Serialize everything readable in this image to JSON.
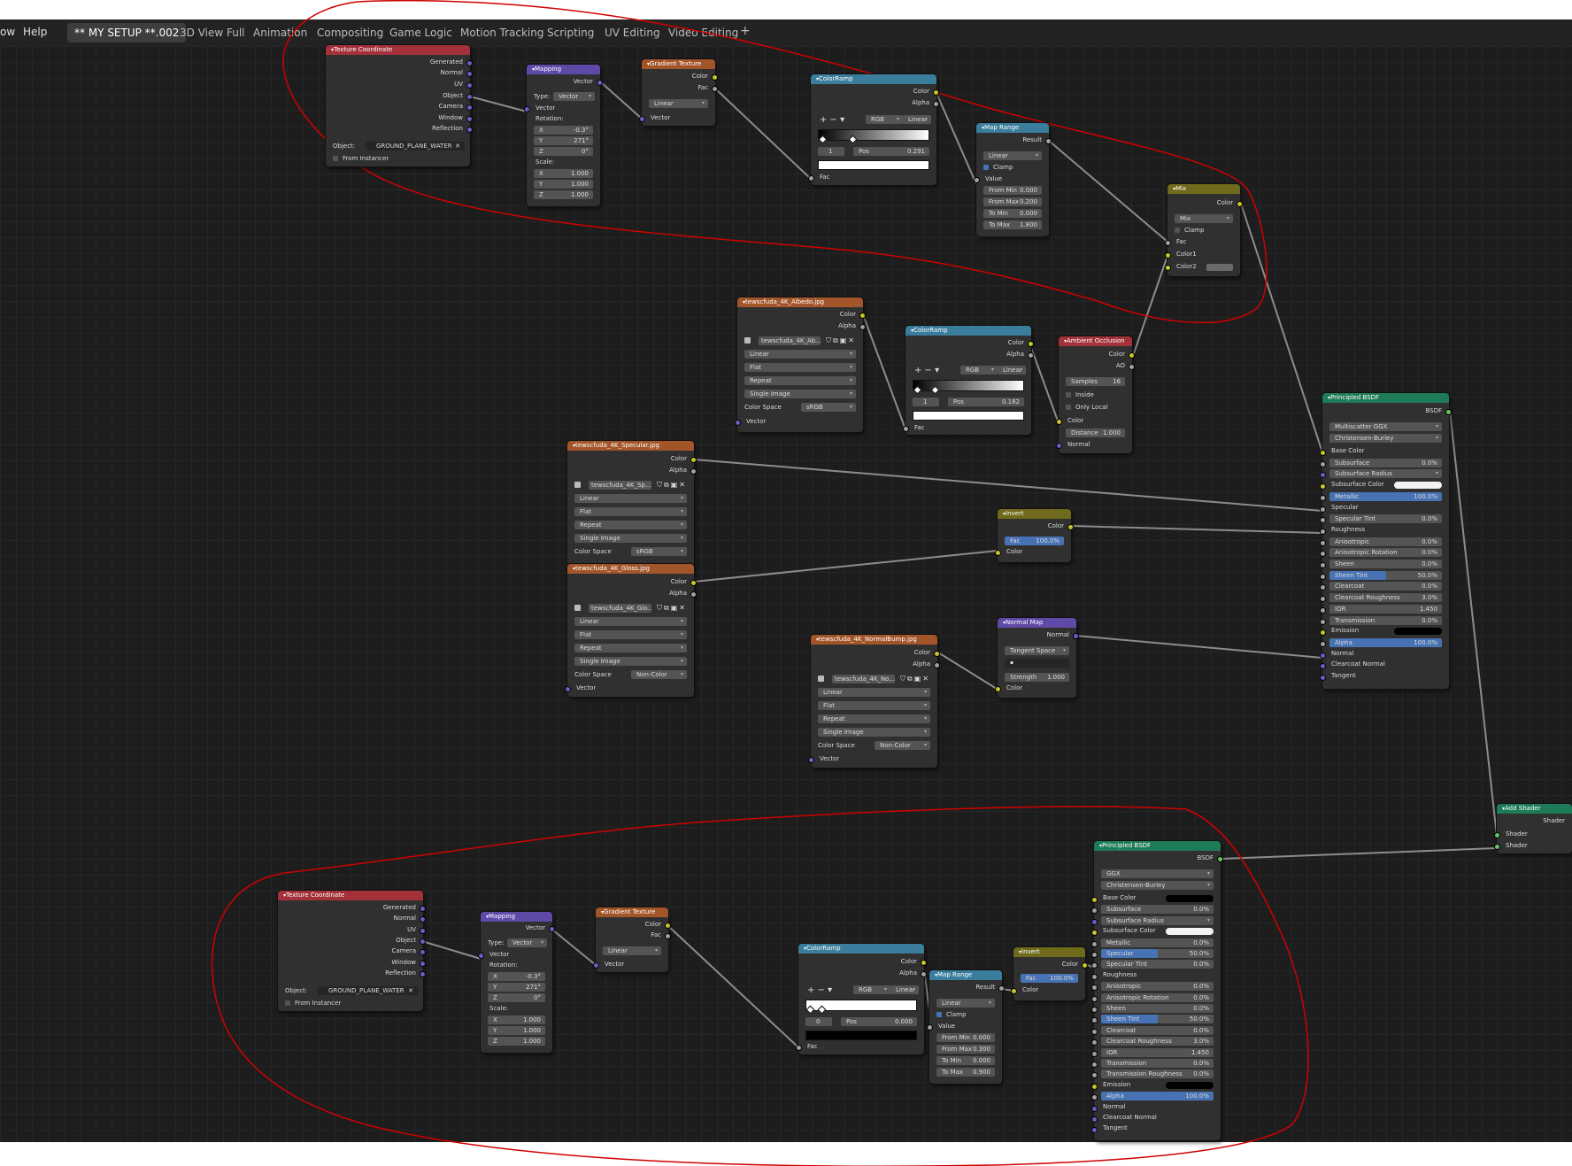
{
  "menu": {
    "items": [
      "ow",
      "Help"
    ],
    "workspaces": [
      "** MY SETUP **.002",
      "3D View Full",
      "Animation",
      "Compositing",
      "Game Logic",
      "Motion Tracking",
      "Scripting",
      "UV Editing",
      "Video Editing",
      "+"
    ]
  },
  "colors": {
    "texture_header": "#a3313a",
    "vector_header": "#5f4aa8",
    "image_header": "#a3552a",
    "converter_header": "#3a7d9c",
    "color_header": "#6f6a1c",
    "shader_header": "#1e7b58",
    "annotation": "#d10000"
  },
  "nodes": {
    "texcoord_top": {
      "title": "Texture Coordinate",
      "outs": [
        "Generated",
        "Normal",
        "UV",
        "Object",
        "Camera",
        "Window",
        "Reflection"
      ],
      "object_label": "Object:",
      "object_value": "GROUND_PLANE_WATER",
      "from_instancer": "From Instancer"
    },
    "mapping_top": {
      "title": "Mapping",
      "out": "Vector",
      "type_label": "Type:",
      "type_value": "Vector",
      "vector": "Vector",
      "rotation": "Rotation:",
      "rot": [
        [
          "X",
          "-0.3°"
        ],
        [
          "Y",
          "271°"
        ],
        [
          "Z",
          "0°"
        ]
      ],
      "scale": "Scale:",
      "scl": [
        [
          "X",
          "1.000"
        ],
        [
          "Y",
          "1.000"
        ],
        [
          "Z",
          "1.000"
        ]
      ]
    },
    "gradient_top": {
      "title": "Gradient Texture",
      "outs": [
        "Color",
        "Fac"
      ],
      "mode": "Linear",
      "in": "Vector"
    },
    "ramp_top": {
      "title": "ColorRamp",
      "outs": [
        "Color",
        "Alpha"
      ],
      "mode": "RGB",
      "interp": "Linear",
      "index": "1",
      "pos_label": "Pos",
      "pos": "0.291",
      "in": "Fac"
    },
    "maprange_top": {
      "title": "Map Range",
      "out": "Result",
      "mode": "Linear",
      "clamp": "Clamp",
      "value": "Value",
      "rows": [
        [
          "From Min",
          "0.000"
        ],
        [
          "From Max",
          "0.200"
        ],
        [
          "To Min",
          "0.000"
        ],
        [
          "To Max",
          "1.800"
        ]
      ]
    },
    "mix": {
      "title": "Mix",
      "out": "Color",
      "mode": "Mix",
      "clamp": "Clamp",
      "ins": [
        "Fac",
        "Color1",
        "Color2"
      ]
    },
    "albedo": {
      "title": "tewscfuda_4K_Albedo.jpg",
      "outs": [
        "Color",
        "Alpha"
      ],
      "file": "tewscfuda_4K_Ab...",
      "opts": [
        "Linear",
        "Flat",
        "Repeat",
        "Single Image"
      ],
      "cs_label": "Color Space",
      "cs": "sRGB",
      "in": "Vector"
    },
    "ramp_mid": {
      "title": "ColorRamp",
      "outs": [
        "Color",
        "Alpha"
      ],
      "mode": "RGB",
      "interp": "Linear",
      "index": "1",
      "pos_label": "Pos",
      "pos": "0.182",
      "in": "Fac"
    },
    "ao": {
      "title": "Ambient Occlusion",
      "outs": [
        "Color",
        "AO"
      ],
      "samples_label": "Samples",
      "samples": "16",
      "inside": "Inside",
      "only_local": "Only Local",
      "ins": [
        "Color",
        "Normal"
      ],
      "dist_label": "Distance",
      "dist": "1.000"
    },
    "specular": {
      "title": "tewscfuda_4K_Specular.jpg",
      "outs": [
        "Color",
        "Alpha"
      ],
      "file": "tewscfuda_4K_Sp...",
      "opts": [
        "Linear",
        "Flat",
        "Repeat",
        "Single Image"
      ],
      "cs_label": "Color Space",
      "cs": "sRGB"
    },
    "gloss": {
      "title": "tewscfuda_4K_Gloss.jpg",
      "outs": [
        "Color",
        "Alpha"
      ],
      "file": "tewscfuda_4K_Glo...",
      "opts": [
        "Linear",
        "Flat",
        "Repeat",
        "Single Image"
      ],
      "cs_label": "Color Space",
      "cs": "Non-Color",
      "in": "Vector"
    },
    "invert_mid": {
      "title": "Invert",
      "out": "Color",
      "fac_label": "Fac",
      "fac": "100.0%",
      "in": "Color"
    },
    "normalmap": {
      "title": "Normal Map",
      "out": "Normal",
      "space": "Tangent Space",
      "strength_label": "Strength",
      "strength": "1.000",
      "in": "Color"
    },
    "normalbump": {
      "title": "tewscfuda_4K_NormalBump.jpg",
      "outs": [
        "Color",
        "Alpha"
      ],
      "file": "tewscfuda_4K_No...",
      "opts": [
        "Linear",
        "Flat",
        "Repeat",
        "Single Image"
      ],
      "cs_label": "Color Space",
      "cs": "Non-Color",
      "in": "Vector"
    },
    "bsdf_top": {
      "title": "Principled BSDF",
      "out": "BSDF",
      "dist": "Multiscatter GGX",
      "sss": "Christensen-Burley",
      "rows": [
        [
          "Base Color",
          ""
        ],
        [
          "Subsurface",
          "0.0%"
        ],
        [
          "Subsurface Radius",
          ""
        ],
        [
          "Subsurface Color",
          ""
        ],
        [
          "Metallic",
          "100.0%"
        ],
        [
          "Specular",
          ""
        ],
        [
          "Specular Tint",
          "0.0%"
        ],
        [
          "Roughness",
          ""
        ],
        [
          "Anisotropic",
          "0.0%"
        ],
        [
          "Anisotropic Rotation",
          "0.0%"
        ],
        [
          "Sheen",
          "0.0%"
        ],
        [
          "Sheen Tint",
          "50.0%"
        ],
        [
          "Clearcoat",
          "0.0%"
        ],
        [
          "Clearcoat Roughness",
          "3.0%"
        ],
        [
          "IOR",
          "1.450"
        ],
        [
          "Transmission",
          "0.0%"
        ],
        [
          "Emission",
          ""
        ],
        [
          "Alpha",
          "100.0%"
        ],
        [
          "Normal",
          ""
        ],
        [
          "Clearcoat Normal",
          ""
        ],
        [
          "Tangent",
          ""
        ]
      ]
    },
    "addshader": {
      "title": "Add Shader",
      "out": "Shader",
      "ins": [
        "Shader",
        "Shader"
      ]
    },
    "texcoord_bot": {
      "title": "Texture Coordinate",
      "outs": [
        "Generated",
        "Normal",
        "UV",
        "Object",
        "Camera",
        "Window",
        "Reflection"
      ],
      "object_label": "Object:",
      "object_value": "GROUND_PLANE_WATER",
      "from_instancer": "From Instancer"
    },
    "mapping_bot": {
      "title": "Mapping",
      "out": "Vector",
      "type_label": "Type:",
      "type_value": "Vector",
      "vector": "Vector",
      "rotation": "Rotation:",
      "rot": [
        [
          "X",
          "-0.3°"
        ],
        [
          "Y",
          "271°"
        ],
        [
          "Z",
          "0°"
        ]
      ],
      "scale": "Scale:",
      "scl": [
        [
          "X",
          "1.000"
        ],
        [
          "Y",
          "1.000"
        ],
        [
          "Z",
          "1.000"
        ]
      ]
    },
    "gradient_bot": {
      "title": "Gradient Texture",
      "outs": [
        "Color",
        "Fac"
      ],
      "mode": "Linear",
      "in": "Vector"
    },
    "ramp_bot": {
      "title": "ColorRamp",
      "outs": [
        "Color",
        "Alpha"
      ],
      "mode": "RGB",
      "interp": "Linear",
      "index": "0",
      "pos_label": "Pos",
      "pos": "0.000",
      "in": "Fac"
    },
    "maprange_bot": {
      "title": "Map Range",
      "out": "Result",
      "mode": "Linear",
      "clamp": "Clamp",
      "value": "Value",
      "rows": [
        [
          "From Min",
          "0.000"
        ],
        [
          "From Max",
          "0.300"
        ],
        [
          "To Min",
          "0.000"
        ],
        [
          "To Max",
          "0.900"
        ]
      ]
    },
    "invert_bot": {
      "title": "Invert",
      "out": "Color",
      "fac_label": "Fac",
      "fac": "100.0%",
      "in": "Color"
    },
    "bsdf_bot": {
      "title": "Principled BSDF",
      "out": "BSDF",
      "dist": "GGX",
      "sss": "Christensen-Burley",
      "rows": [
        [
          "Base Color",
          ""
        ],
        [
          "Subsurface",
          "0.0%"
        ],
        [
          "Subsurface Radius",
          ""
        ],
        [
          "Subsurface Color",
          ""
        ],
        [
          "Metallic",
          "0.0%"
        ],
        [
          "Specular",
          "50.0%"
        ],
        [
          "Specular Tint",
          "0.0%"
        ],
        [
          "Roughness",
          ""
        ],
        [
          "Anisotropic",
          "0.0%"
        ],
        [
          "Anisotropic Rotation",
          "0.0%"
        ],
        [
          "Sheen",
          "0.0%"
        ],
        [
          "Sheen Tint",
          "50.0%"
        ],
        [
          "Clearcoat",
          "0.0%"
        ],
        [
          "Clearcoat Roughness",
          "3.0%"
        ],
        [
          "IOR",
          "1.450"
        ],
        [
          "Transmission",
          "0.0%"
        ],
        [
          "Transmission Roughness",
          "0.0%"
        ],
        [
          "Emission",
          ""
        ],
        [
          "Alpha",
          "100.0%"
        ],
        [
          "Normal",
          ""
        ],
        [
          "Clearcoat Normal",
          ""
        ],
        [
          "Tangent",
          ""
        ]
      ]
    }
  }
}
